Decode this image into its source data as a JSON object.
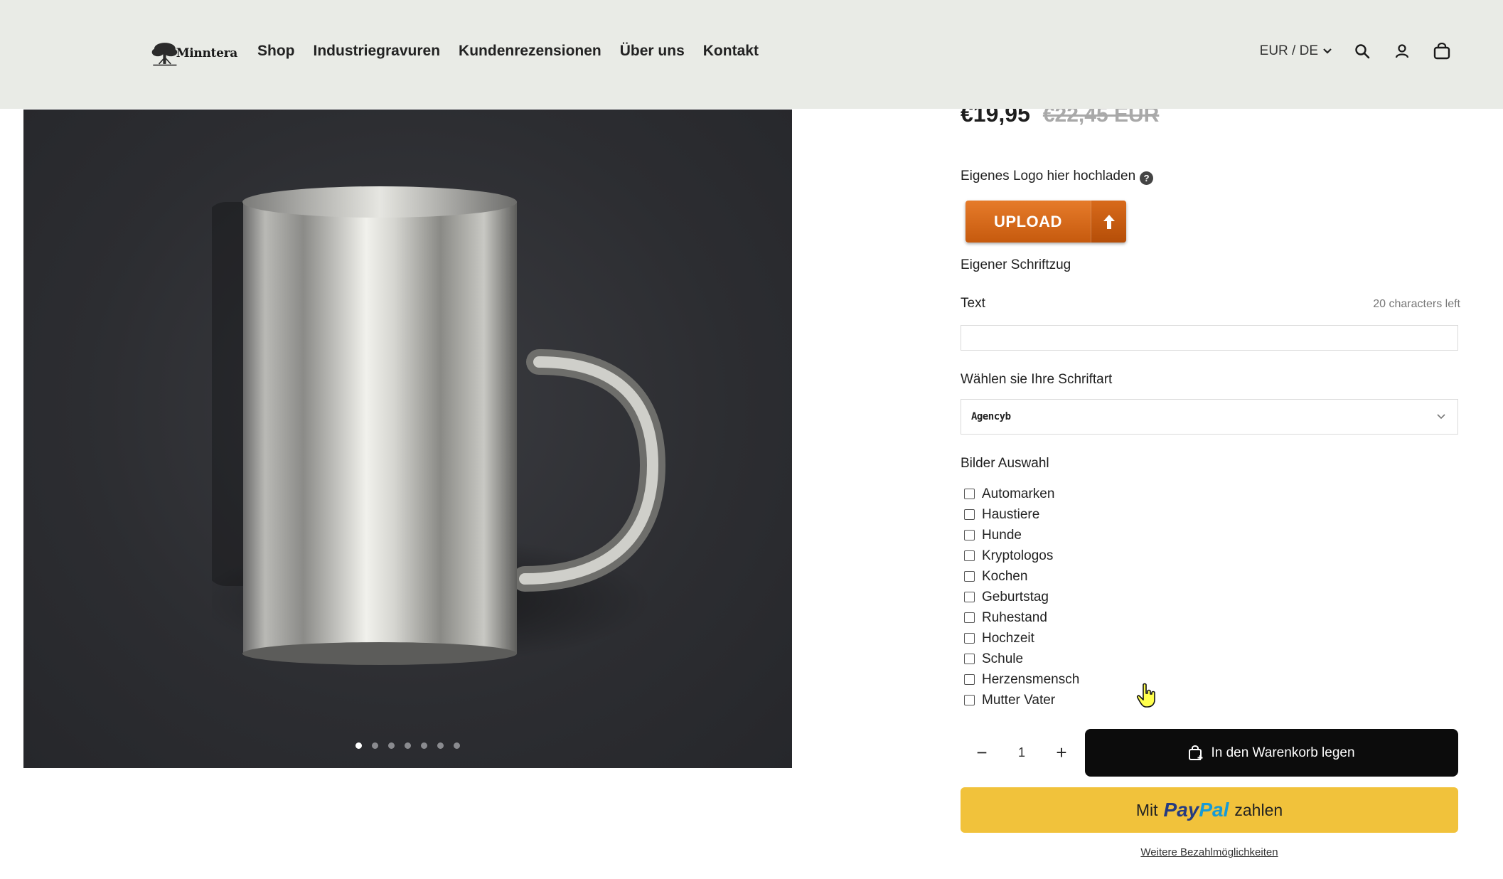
{
  "header": {
    "logo_text": "Minntera",
    "nav": [
      "Shop",
      "Industriegravuren",
      "Kundenrezensionen",
      "Über uns",
      "Kontakt"
    ],
    "locale": "EUR / DE"
  },
  "gallery": {
    "dots_count": 7,
    "active_dot": 1
  },
  "product": {
    "price": "€19,95",
    "price_old": "€22,45 EUR"
  },
  "form": {
    "logo_label": "Eigenes Logo hier hochladen",
    "upload_label": "UPLOAD",
    "lettering_heading": "Eigener Schriftzug",
    "text_label": "Text",
    "chars_left": "20 characters left",
    "text_value": "",
    "font_label": "Wählen sie Ihre Schriftart",
    "font_value": "Agencyb",
    "images_label": "Bilder Auswahl",
    "image_options": [
      "Automarken",
      "Haustiere",
      "Hunde",
      "Kryptologos",
      "Kochen",
      "Geburtstag",
      "Ruhestand",
      "Hochzeit",
      "Schule",
      "Herzensmensch",
      "Mutter Vater"
    ]
  },
  "purchase": {
    "qty_minus": "−",
    "quantity": "1",
    "qty_plus": "+",
    "add_to_cart": "In den Warenkorb legen",
    "paypal_prefix": "Mit",
    "paypal_brand_1": "Pay",
    "paypal_brand_2": "Pal",
    "paypal_suffix": "zahlen",
    "more_payment": "Weitere Bezahlmöglichkeiten"
  },
  "colors": {
    "header_bg": "#e9ebe6",
    "upload_orange": "#e67b2a",
    "cart_black": "#0c0c0c",
    "paypal_yellow": "#f1c23b"
  }
}
